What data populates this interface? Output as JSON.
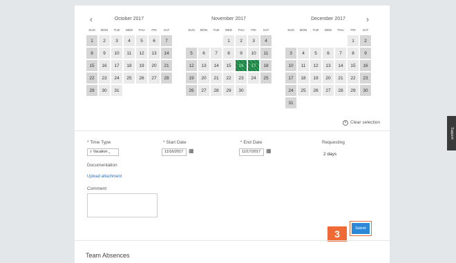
{
  "calendars": [
    {
      "month": "October 2017",
      "offset": 0,
      "days": 31,
      "selected": []
    },
    {
      "month": "November 2017",
      "offset": 3,
      "days": 30,
      "selected": [
        16,
        17
      ]
    },
    {
      "month": "December 2017",
      "offset": 5,
      "days": 31,
      "selected": []
    }
  ],
  "weekdays": [
    "SUN",
    "MON",
    "TUE",
    "WED",
    "THU",
    "FRI",
    "SAT"
  ],
  "nav": {
    "prev": "‹",
    "next": "›"
  },
  "clear_selection": "Clear selection",
  "form": {
    "time_type_label": "* Time Type",
    "time_type_value": "Vacation",
    "start_date_label": "* Start Date",
    "start_date_value": "11/16/2017",
    "end_date_label": "* End Date",
    "end_date_value": "11/17/2017",
    "requesting_label": "Requesting",
    "requesting_value": "2 days",
    "documentation_label": "Documentation",
    "upload_link": "Upload attachment",
    "comment_label": "Comment"
  },
  "submit_label": "Submit",
  "step_number": "3",
  "team_absences": "Team Absences",
  "support_tab": "Support"
}
